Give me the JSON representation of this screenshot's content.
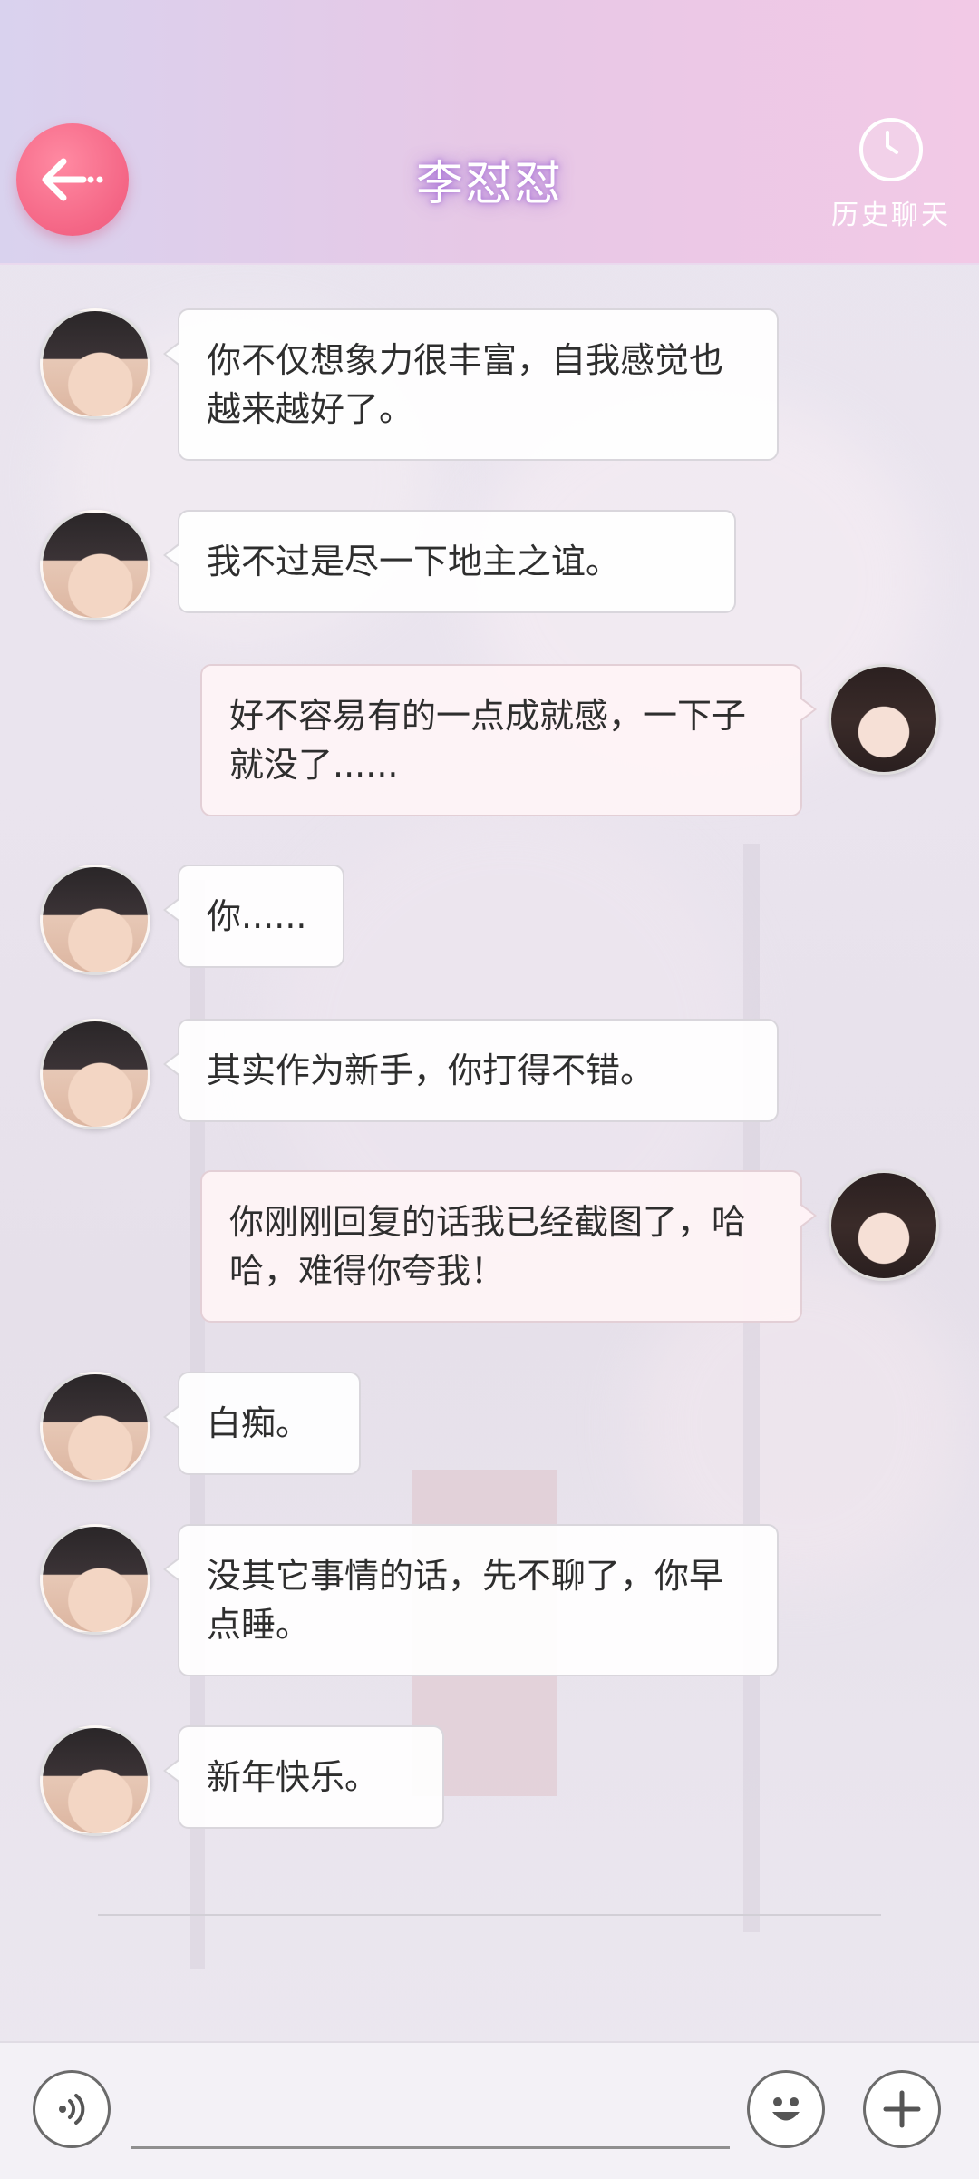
{
  "header": {
    "title": "李怼怼",
    "history_label": "历史聊天"
  },
  "messages": [
    {
      "side": "left",
      "text": "你不仅想象力很丰富，自我感觉也越来越好了。"
    },
    {
      "side": "left",
      "text": "我不过是尽一下地主之谊。"
    },
    {
      "side": "right",
      "text": "好不容易有的一点成就感，一下子就没了......"
    },
    {
      "side": "left",
      "text": "你......"
    },
    {
      "side": "left",
      "text": "其实作为新手，你打得不错。"
    },
    {
      "side": "right",
      "text": "你刚刚回复的话我已经截图了，哈哈，难得你夸我！"
    },
    {
      "side": "left",
      "text": "白痴。"
    },
    {
      "side": "left",
      "text": "没其它事情的话，先不聊了，你早点睡。"
    },
    {
      "side": "left",
      "text": "新年快乐。"
    }
  ],
  "icons": {
    "back": "back-arrow-icon",
    "history": "clock-icon",
    "voice": "voice-icon",
    "emoji": "emoji-icon",
    "more": "plus-icon"
  },
  "colors": {
    "back_button": "#f46585",
    "header_start": "#d9d2ee",
    "header_end": "#f2c9e6"
  }
}
